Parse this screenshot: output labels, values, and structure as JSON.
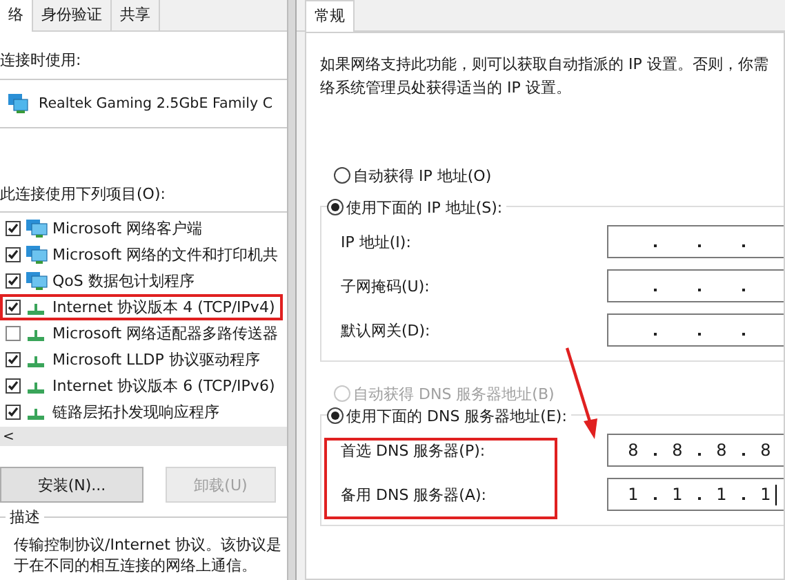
{
  "left_dialog": {
    "tabs": [
      {
        "label": "络",
        "selected": true
      },
      {
        "label": "身份验证",
        "selected": false
      },
      {
        "label": "共享",
        "selected": false
      }
    ],
    "connect_using_label": "连接时使用:",
    "adapter": "Realtek Gaming 2.5GbE Family C",
    "items_label": "此连接使用下列项目(O):",
    "items": [
      {
        "kind": "client",
        "label": "Microsoft 网络客户端",
        "checked": true,
        "highlighted": false
      },
      {
        "kind": "client",
        "label": "Microsoft 网络的文件和打印机共",
        "checked": true,
        "highlighted": false
      },
      {
        "kind": "client",
        "label": "QoS 数据包计划程序",
        "checked": true,
        "highlighted": false
      },
      {
        "kind": "protocol",
        "label": "Internet 协议版本 4 (TCP/IPv4)",
        "checked": true,
        "highlighted": true
      },
      {
        "kind": "protocol",
        "label": "Microsoft 网络适配器多路传送器",
        "checked": false,
        "highlighted": false
      },
      {
        "kind": "protocol",
        "label": "Microsoft LLDP 协议驱动程序",
        "checked": true,
        "highlighted": false
      },
      {
        "kind": "protocol",
        "label": "Internet 协议版本 6 (TCP/IPv6)",
        "checked": true,
        "highlighted": false
      },
      {
        "kind": "protocol",
        "label": "链路层拓扑发现响应程序",
        "checked": true,
        "highlighted": false
      }
    ],
    "scroll_left": "<",
    "buttons": [
      {
        "label": "安装(N)...",
        "disabled": false
      },
      {
        "label": "卸载(U)",
        "disabled": true
      }
    ],
    "description_title": "描述",
    "description": [
      "传输控制协议/Internet 协议。该协议是",
      "于在不同的相互连接的网络上通信。"
    ]
  },
  "right_dialog": {
    "tabs": [
      {
        "label": "常规",
        "selected": true
      }
    ],
    "intro": [
      "如果网络支持此功能，则可以获取自动指派的 IP 设置。否则，你需",
      "络系统管理员处获得适当的 IP 设置。"
    ],
    "ip_radios": [
      {
        "label": "自动获得 IP 地址(O)",
        "selected": false,
        "disabled": false
      },
      {
        "label": "使用下面的 IP 地址(S):",
        "selected": true,
        "disabled": false
      }
    ],
    "ip_fields": [
      {
        "label": "IP 地址(I):"
      },
      {
        "label": "子网掩码(U):"
      },
      {
        "label": "默认网关(D):"
      }
    ],
    "dns_radios": [
      {
        "label": "自动获得 DNS 服务器地址(B)",
        "selected": false,
        "disabled": true
      },
      {
        "label": "使用下面的 DNS 服务器地址(E):",
        "selected": true,
        "disabled": false
      }
    ],
    "dns_fields": [
      {
        "label": "首选 DNS 服务器(P):",
        "octets": [
          "8",
          "8",
          "8",
          "8"
        ]
      },
      {
        "label": "备用 DNS 服务器(A):",
        "octets": [
          "1",
          "1",
          "1",
          "1"
        ],
        "focused": true
      }
    ],
    "dns_highlighted": true,
    "arrow_annotation": true
  }
}
